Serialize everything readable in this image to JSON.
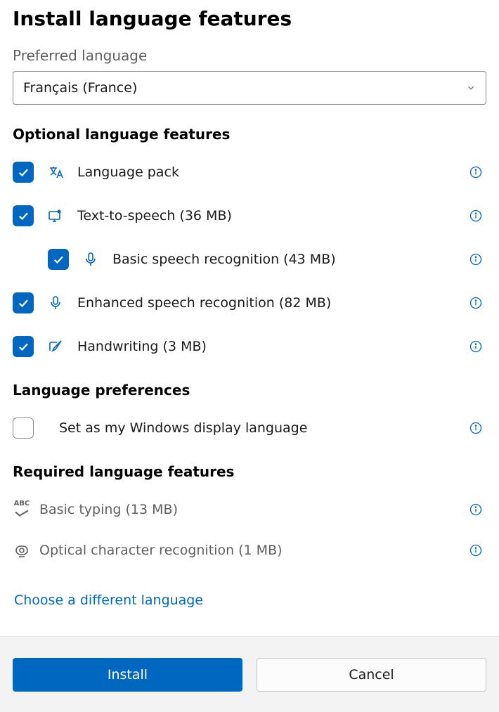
{
  "title": "Install language features",
  "preferred": {
    "label": "Preferred language",
    "value": "Français (France)"
  },
  "sections": {
    "optional_head": "Optional language features",
    "prefs_head": "Language preferences",
    "required_head": "Required language features"
  },
  "optional": {
    "language_pack": {
      "label": "Language pack",
      "checked": true
    },
    "tts": {
      "label": "Text-to-speech (36 MB)",
      "checked": true
    },
    "basic_speech": {
      "label": "Basic speech recognition (43 MB)",
      "checked": true
    },
    "enh_speech": {
      "label": "Enhanced speech recognition (82 MB)",
      "checked": true
    },
    "handwriting": {
      "label": "Handwriting (3 MB)",
      "checked": true
    }
  },
  "prefs": {
    "display_lang": {
      "label": "Set as my Windows display language",
      "checked": false
    }
  },
  "required": {
    "basic_typing": {
      "label": "Basic typing (13 MB)"
    },
    "ocr": {
      "label": "Optical character recognition (1 MB)"
    }
  },
  "link": "Choose a different language",
  "footer": {
    "install": "Install",
    "cancel": "Cancel"
  }
}
